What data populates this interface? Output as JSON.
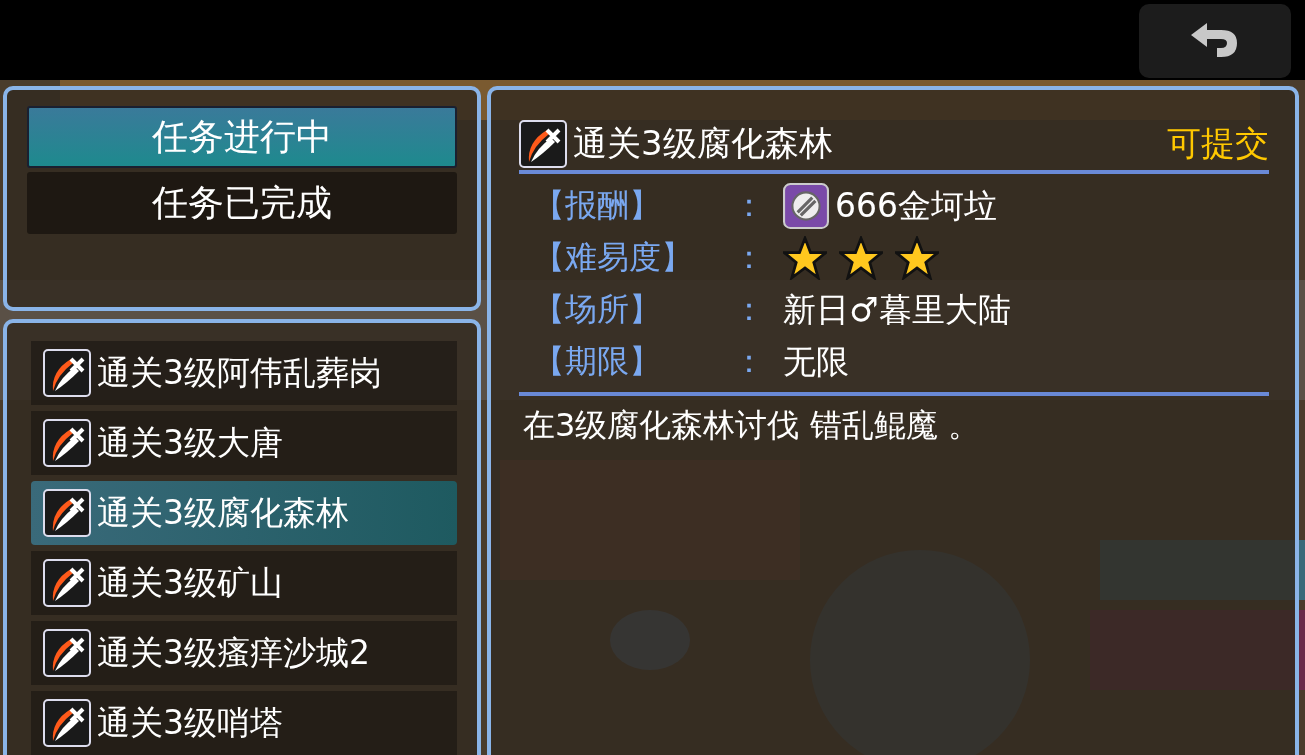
{
  "tabs": [
    {
      "label": "任务进行中",
      "selected": true
    },
    {
      "label": "任务已完成",
      "selected": false
    }
  ],
  "quests": [
    {
      "title": "通关3级阿伟乱葬岗",
      "selected": false
    },
    {
      "title": "通关3级大唐",
      "selected": false
    },
    {
      "title": "通关3级腐化森林",
      "selected": true
    },
    {
      "title": "通关3级矿山",
      "selected": false
    },
    {
      "title": "通关3级瘙痒沙城2",
      "selected": false
    },
    {
      "title": "通关3级哨塔",
      "selected": false
    }
  ],
  "detail": {
    "title": "通关3级腐化森林",
    "status": "可提交",
    "fields": [
      {
        "kind": "reward",
        "label": "【报酬】",
        "colon": "：",
        "value": "666金坷垃"
      },
      {
        "kind": "stars",
        "label": "【难易度】",
        "colon": "：",
        "stars": 3
      },
      {
        "kind": "text",
        "label": "【场所】",
        "colon": "：",
        "value": "新日♂暮里大陆"
      },
      {
        "kind": "text",
        "label": "【期限】",
        "colon": "：",
        "value": "无限"
      }
    ],
    "description": "在3级腐化森林讨伐 错乱鲲魔 。"
  }
}
